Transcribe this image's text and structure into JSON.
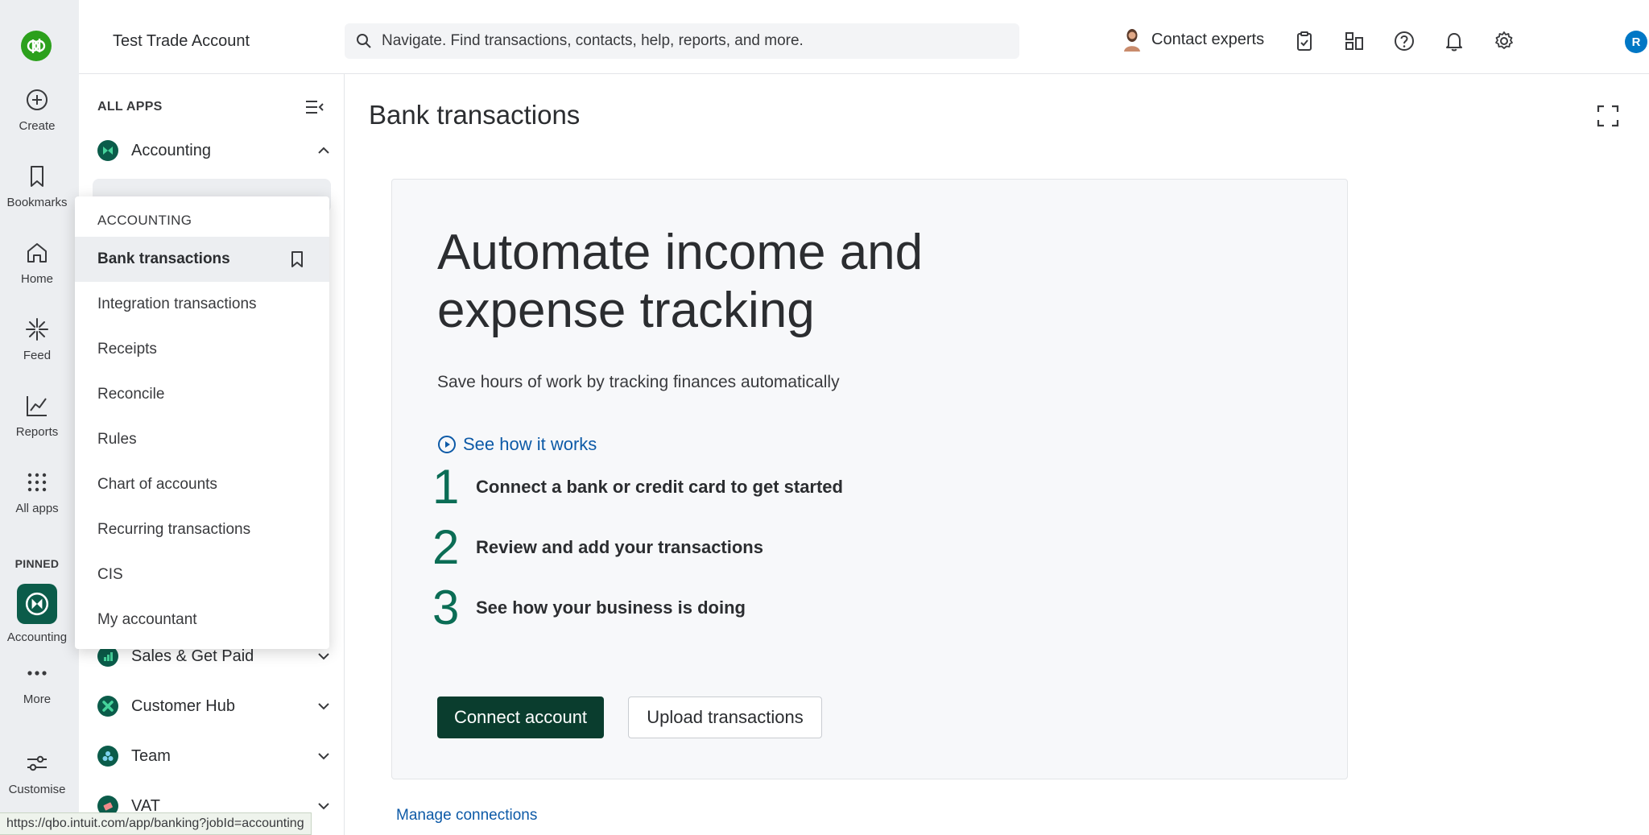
{
  "rail": {
    "items": [
      {
        "label": "Create",
        "icon": "plus-circle-icon"
      },
      {
        "label": "Bookmarks",
        "icon": "bookmark-icon"
      },
      {
        "label": "Home",
        "icon": "home-icon"
      },
      {
        "label": "Feed",
        "icon": "sparkle-icon"
      },
      {
        "label": "Reports",
        "icon": "line-chart-icon"
      },
      {
        "label": "All apps",
        "icon": "grid-icon"
      }
    ],
    "pinned_label": "PINNED",
    "pinned_item": "Accounting",
    "more_label": "More",
    "customise_label": "Customise"
  },
  "topbar": {
    "company": "Test Trade Account",
    "search_placeholder": "Navigate. Find transactions, contacts, help, reports, and more.",
    "contact_label": "Contact experts",
    "user_initial": "R"
  },
  "panel": {
    "all_apps_label": "ALL APPS",
    "apps": [
      {
        "name": "Accounting",
        "color": "#0b5c4a"
      },
      {
        "name": "Sales & Get Paid",
        "color": "#0b5c4a"
      },
      {
        "name": "Customer Hub",
        "color": "#0b5c4a"
      },
      {
        "name": "Team",
        "color": "#0b5c4a"
      },
      {
        "name": "VAT",
        "color": "#0b5c4a"
      }
    ]
  },
  "flyout": {
    "heading": "ACCOUNTING",
    "items": [
      "Bank transactions",
      "Integration transactions",
      "Receipts",
      "Reconcile",
      "Rules",
      "Chart of accounts",
      "Recurring transactions",
      "CIS",
      "My accountant"
    ]
  },
  "main": {
    "title": "Bank transactions",
    "hero_line1": "Automate income and",
    "hero_line2": "expense tracking",
    "subtitle": "Save hours of work by tracking finances automatically",
    "how_link": "See how it works",
    "steps": [
      {
        "num": "1",
        "text": "Connect a bank or credit card to get started"
      },
      {
        "num": "2",
        "text": "Review and add your transactions"
      },
      {
        "num": "3",
        "text": "See how your business is doing"
      }
    ],
    "connect_button": "Connect account",
    "upload_button": "Upload transactions",
    "manage_link": "Manage connections"
  },
  "status_url": "https://qbo.intuit.com/app/banking?jobId=accounting",
  "colors": {
    "brand_green": "#2ca01c",
    "dark_green": "#0a3d2e",
    "step_green": "#0b6d55",
    "link_blue": "#0d5aa7"
  }
}
